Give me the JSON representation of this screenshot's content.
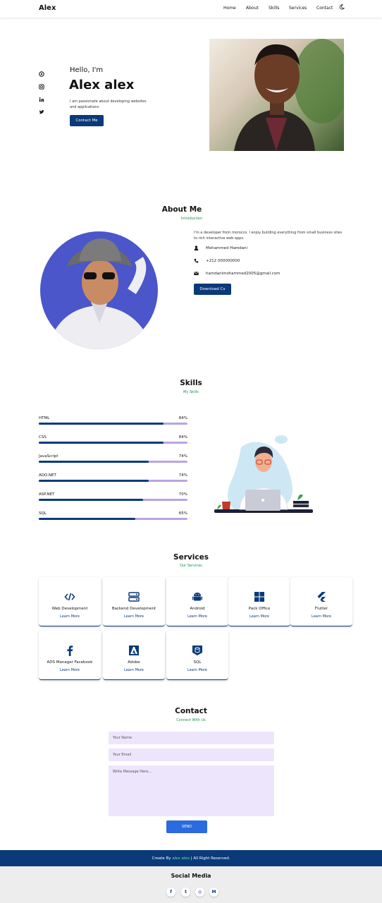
{
  "header": {
    "logo": "Alex",
    "nav": [
      "Home",
      "About",
      "Skills",
      "Services",
      "Contact"
    ]
  },
  "hero": {
    "greeting": "Hello, I'm",
    "name": "Alex alex",
    "description": "I am passionate about developing websites and applications",
    "cta": "Contact Me",
    "social_icons": [
      "github-icon",
      "instagram-icon",
      "linkedin-icon",
      "twitter-icon"
    ]
  },
  "about": {
    "title": "About Me",
    "subtitle": "Introduction",
    "text": "I'm a developer from morocco. I enjoy building everything from small business sites to rich interactive web apps.",
    "name": "Mohammed Hamdani",
    "phone": "+212 000000000",
    "email": "hamdanimohammed2005@gmail.com",
    "cta": "Download Cv"
  },
  "skills": {
    "title": "Skills",
    "subtitle": "My Skills",
    "items": [
      {
        "name": "HTML",
        "level": "84%"
      },
      {
        "name": "CSS",
        "level": "84%"
      },
      {
        "name": "JavaScript",
        "level": "74%"
      },
      {
        "name": "ADO.NET",
        "level": "74%"
      },
      {
        "name": "ASP.NET",
        "level": "70%"
      },
      {
        "name": "SQL",
        "level": "65%"
      }
    ]
  },
  "services": {
    "title": "Services",
    "subtitle": "Our Services",
    "learn_more": "Learn More",
    "cards": [
      {
        "title": "Web Development",
        "icon": "code-icon"
      },
      {
        "title": "Backend Development",
        "icon": "server-icon"
      },
      {
        "title": "Android",
        "icon": "android-icon"
      },
      {
        "title": "Pack Office",
        "icon": "windows-icon"
      },
      {
        "title": "Flutter",
        "icon": "flutter-icon"
      },
      {
        "title": "ADS Manager Facebook",
        "icon": "facebook-icon"
      },
      {
        "title": "Adobe",
        "icon": "adobe-icon"
      },
      {
        "title": "SQL",
        "icon": "database-icon"
      }
    ]
  },
  "contact": {
    "title": "Contact",
    "subtitle": "Connect With Us",
    "name_placeholder": "Your Name",
    "email_placeholder": "Your Email",
    "message_placeholder": "Write Message Here...",
    "send": "SEND"
  },
  "footer": {
    "credit_prefix": "Create By",
    "credit_name": "alex alex",
    "credit_suffix": "| All Right Reserved.",
    "social_title": "Social Media",
    "social_icons": [
      "facebook-icon",
      "twitter-icon",
      "instagram-icon",
      "gmail-icon"
    ]
  },
  "colors": {
    "primary": "#0a3a7a",
    "accent": "#19924a",
    "bar_track": "#b9a4e4",
    "field_bg": "#ece5fb"
  }
}
